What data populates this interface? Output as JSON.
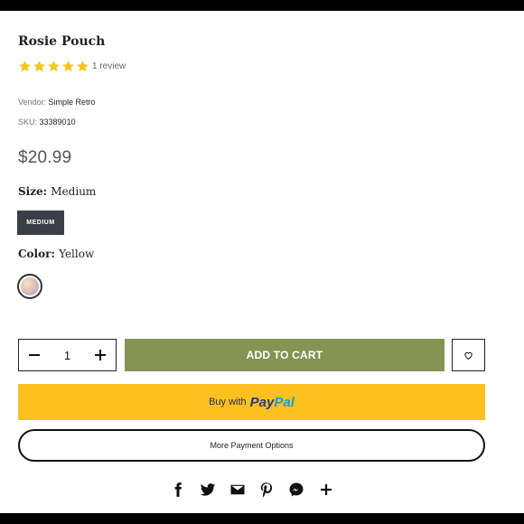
{
  "product": {
    "title": "Rosie Pouch",
    "rating_stars": 5,
    "review_count": "1 review",
    "vendor_label": "Vendor:",
    "vendor_value": "Simple Retro",
    "sku_label": "SKU:",
    "sku_value": "33389010",
    "price": "$20.99"
  },
  "options": {
    "size_label": "Size:",
    "size_value": "Medium",
    "size_chip": "MEDIUM",
    "color_label": "Color:",
    "color_value": "Yellow"
  },
  "cart": {
    "quantity": "1",
    "add_to_cart": "ADD TO CART"
  },
  "payment": {
    "paypal_prefix": "Buy with",
    "paypal_brand_1": "Pay",
    "paypal_brand_2": "Pal",
    "more_options": "More Payment Options"
  },
  "share_icons": [
    "facebook-icon",
    "twitter-icon",
    "email-icon",
    "pinterest-icon",
    "messenger-icon",
    "plus-icon"
  ],
  "colors": {
    "star": "#f5c518",
    "add_to_cart_bg": "#859452",
    "paypal_bg": "#fcc121",
    "size_chip_bg": "#3a3f47"
  }
}
